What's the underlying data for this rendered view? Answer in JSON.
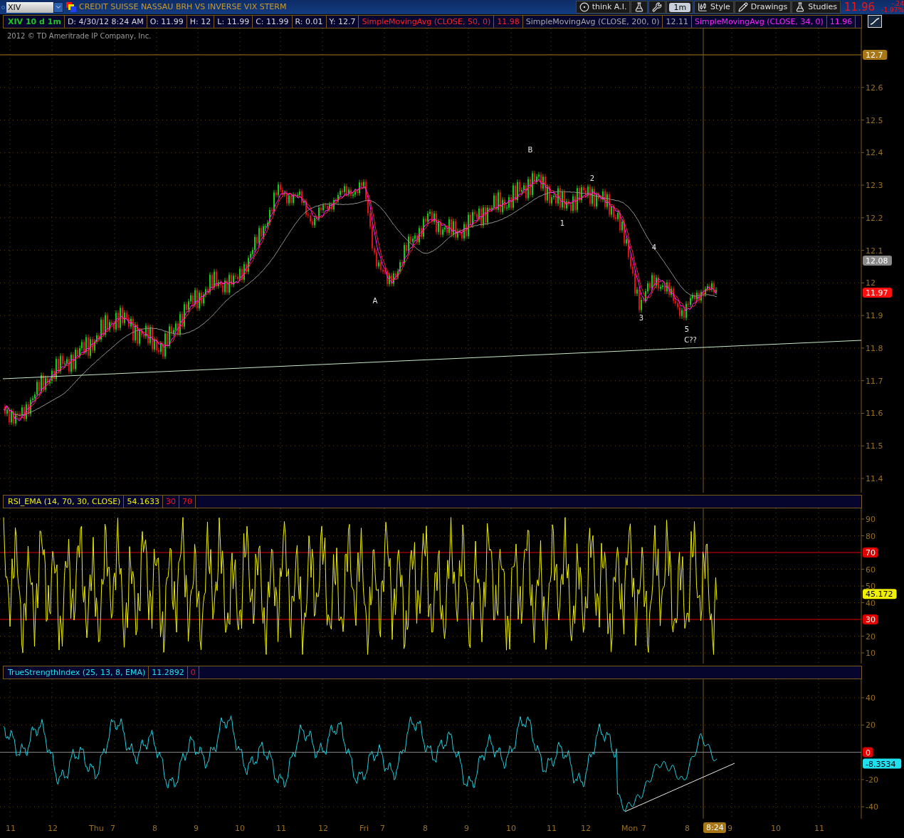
{
  "toolbar": {
    "symbol": "XIV",
    "title": "CREDIT SUISSE NASSAU BRH VS INVERSE VIX STERM",
    "buttons": [
      {
        "kind": "ai",
        "label": "think A.I."
      },
      {
        "kind": "flask-arrow"
      },
      {
        "kind": "wrench"
      },
      {
        "kind": "aggregation",
        "label": "1m"
      },
      {
        "kind": "style",
        "label": "Style"
      },
      {
        "kind": "drawings",
        "label": "Drawings"
      },
      {
        "kind": "studies",
        "label": "Studies"
      }
    ],
    "last": "11.96",
    "change": "-.24",
    "change_pct": "-1.97%"
  },
  "legend": [
    {
      "kind": "symbol",
      "text": "XIV 10 d 1m"
    },
    {
      "kind": "quote",
      "text": "D: 4/30/12 8:24 AM"
    },
    {
      "kind": "quote",
      "text": "O: 11.99"
    },
    {
      "kind": "quote",
      "text": "H: 12"
    },
    {
      "kind": "quote",
      "text": "L: 11.99"
    },
    {
      "kind": "quote",
      "text": "C: 11.99"
    },
    {
      "kind": "quote",
      "text": "R: 0.01"
    },
    {
      "kind": "quote",
      "text": "Y: 12.7"
    },
    {
      "kind": "sma50",
      "text": "SimpleMovingAvg (CLOSE, 50, 0)"
    },
    {
      "kind": "sma50",
      "text": "11.98"
    },
    {
      "kind": "sma200",
      "text": "SimpleMovingAvg (CLOSE, 200, 0)"
    },
    {
      "kind": "sma200",
      "text": "12.11"
    },
    {
      "kind": "sma34",
      "text": "SimpleMovingAvg (CLOSE, 34, 0)"
    },
    {
      "kind": "sma34",
      "text": "11.96"
    }
  ],
  "price_panel": {
    "copyright": "2012 © TD Ameritrade IP Company, Inc.",
    "ticks": [
      "12.6",
      "12.5",
      "12.4",
      "12.3",
      "12.2",
      "12.1",
      "12",
      "11.9",
      "11.8",
      "11.7",
      "11.6",
      "11.5",
      "11.4"
    ],
    "badges": [
      {
        "text": "12.7",
        "color": "#a87818"
      },
      {
        "text": "12.08",
        "color": "#8a8a8a"
      },
      {
        "text": "11.97",
        "color": "#ff1010"
      }
    ],
    "annotations": [
      "B",
      "2",
      "1",
      "A",
      "4",
      "3",
      "5",
      "C??"
    ]
  },
  "rsi_panel": {
    "legend": [
      {
        "kind": "rsi",
        "text": "RSI_EMA (14, 70, 30, CLOSE)"
      },
      {
        "kind": "rsi",
        "text": "54.1633"
      },
      {
        "kind": "level",
        "text": "30"
      },
      {
        "kind": "level",
        "text": "70"
      }
    ],
    "ticks": [
      "90",
      "80",
      "60",
      "50",
      "40",
      "20",
      "10"
    ],
    "badges": [
      {
        "text": "70",
        "color": "#e00000"
      },
      {
        "text": "45.172",
        "color": "#f0f000"
      },
      {
        "text": "30",
        "color": "#e00000"
      }
    ]
  },
  "tsi_panel": {
    "legend": [
      {
        "kind": "tsi",
        "text": "TrueStrengthIndex (25, 13, 8, EMA)"
      },
      {
        "kind": "tsi",
        "text": "11.2892"
      },
      {
        "kind": "level",
        "text": "0"
      }
    ],
    "ticks": [
      "40",
      "20",
      "-20",
      "-40"
    ],
    "badges": [
      {
        "text": "0",
        "color": "#e00000"
      },
      {
        "text": "-8.3534",
        "color": "#20e0f0"
      }
    ]
  },
  "x_axis": {
    "labels": [
      "11",
      "12",
      "Thu",
      "7",
      "8",
      "9",
      "10",
      "11",
      "12",
      "Fri",
      "7",
      "8",
      "9",
      "10",
      "11",
      "12",
      "Mon",
      "7",
      "8",
      "9",
      "10",
      "11"
    ],
    "cursor": "8:24"
  }
}
